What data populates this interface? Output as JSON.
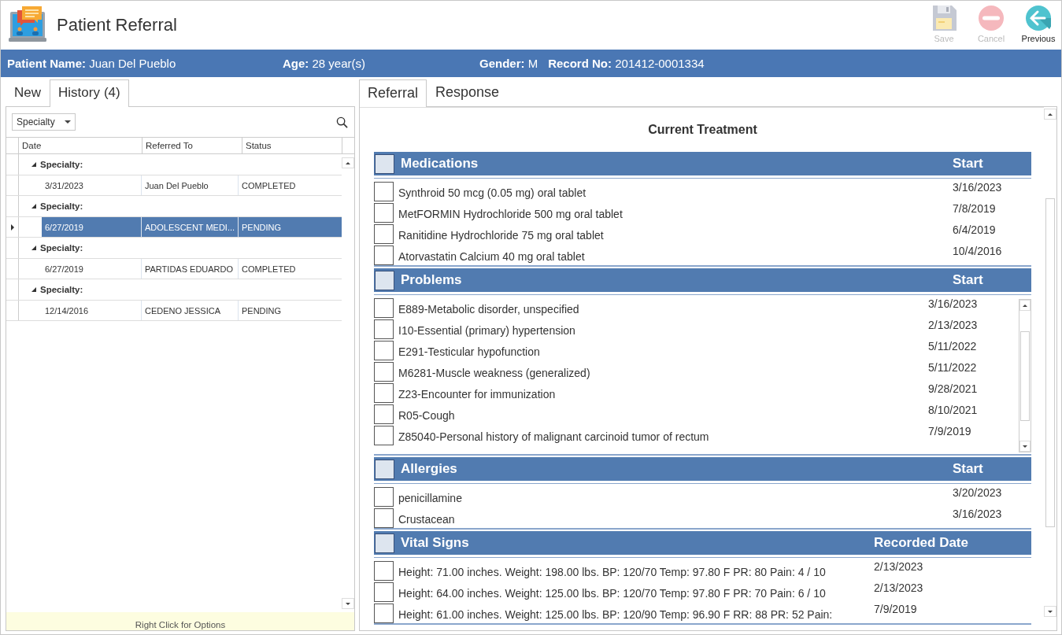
{
  "window": {
    "title": "Patient Referral"
  },
  "toolbar": [
    {
      "label": "Save",
      "kind": "save",
      "disabled": true
    },
    {
      "label": "Cancel",
      "kind": "cancel",
      "disabled": true
    },
    {
      "label": "Previous",
      "kind": "previous",
      "disabled": false
    }
  ],
  "patient_bar": [
    {
      "label": "Patient Name:",
      "value": "Juan Del Pueblo"
    },
    {
      "label": "Age:",
      "value": "28 year(s)"
    },
    {
      "label": "Gender:",
      "value": "M"
    },
    {
      "label": "Record No:",
      "value": "201412-0001334"
    }
  ],
  "left_tabs": [
    {
      "label": "New",
      "selected": false
    },
    {
      "label": "History",
      "count": "(4)",
      "selected": true
    }
  ],
  "filter": {
    "value": "Specialty"
  },
  "grid": {
    "columns": [
      "Date",
      "Referred To",
      "Status"
    ],
    "groups": [
      {
        "label": "Specialty:",
        "expanded": true,
        "rows": [
          {
            "date": "3/31/2023",
            "referred_to": "Juan  Del Pueblo",
            "status": "COMPLETED",
            "selected": false
          }
        ]
      },
      {
        "label": "Specialty:",
        "expanded": true,
        "rows": [
          {
            "date": "6/27/2019",
            "referred_to": "ADOLESCENT MEDI...",
            "status": "PENDING",
            "selected": true
          }
        ]
      },
      {
        "label": "Specialty:",
        "expanded": true,
        "rows": [
          {
            "date": "6/27/2019",
            "referred_to": "PARTIDAS EDUARDO",
            "status": "COMPLETED",
            "selected": false
          }
        ]
      },
      {
        "label": "Specialty:",
        "expanded": true,
        "rows": [
          {
            "date": "12/14/2016",
            "referred_to": "CEDENO JESSICA",
            "status": "PENDING",
            "selected": false
          }
        ]
      }
    ],
    "footer": "Right Click for Options"
  },
  "right_tabs": [
    {
      "label": "Referral",
      "selected": true
    },
    {
      "label": "Response",
      "selected": false
    }
  ],
  "current_treatment": {
    "title": "Current Treatment",
    "sections": [
      {
        "title": "Medications",
        "date_heading": "Start",
        "checked": false,
        "scrolling": false,
        "items": [
          {
            "text": "Synthroid 50 mcg (0.05 mg) oral tablet",
            "date": "3/16/2023",
            "checked": false
          },
          {
            "text": "MetFORMIN Hydrochloride 500 mg oral tablet",
            "date": "7/8/2019",
            "checked": false
          },
          {
            "text": "Ranitidine Hydrochloride 75 mg oral tablet",
            "date": "6/4/2019",
            "checked": false
          },
          {
            "text": "Atorvastatin Calcium 40 mg oral tablet",
            "date": "10/4/2016",
            "checked": false
          }
        ]
      },
      {
        "title": "Problems",
        "date_heading": "Start",
        "checked": false,
        "scrolling": true,
        "items": [
          {
            "text": "E889-Metabolic disorder, unspecified",
            "date": "3/16/2023",
            "checked": false
          },
          {
            "text": "I10-Essential (primary) hypertension",
            "date": "2/13/2023",
            "checked": false
          },
          {
            "text": "E291-Testicular hypofunction",
            "date": "5/11/2022",
            "checked": false
          },
          {
            "text": "M6281-Muscle weakness (generalized)",
            "date": "5/11/2022",
            "checked": false
          },
          {
            "text": "Z23-Encounter for immunization",
            "date": "9/28/2021",
            "checked": false
          },
          {
            "text": "R05-Cough",
            "date": "8/10/2021",
            "checked": false
          },
          {
            "text": "Z85040-Personal history of malignant carcinoid tumor of rectum",
            "date": "7/9/2019",
            "checked": false
          }
        ]
      },
      {
        "title": "Allergies",
        "date_heading": "Start",
        "checked": false,
        "scrolling": false,
        "items": [
          {
            "text": "penicillamine",
            "date": "3/20/2023",
            "checked": false
          },
          {
            "text": "Crustacean",
            "date": "3/16/2023",
            "checked": false
          }
        ]
      },
      {
        "title": "Vital Signs",
        "date_heading": "Recorded Date",
        "checked": false,
        "scrolling": false,
        "items": [
          {
            "text": "Height: 71.00 inches. Weight: 198.00 lbs. BP: 120/70 Temp: 97.80 F PR: 80 Pain: 4 / 10",
            "date": "2/13/2023",
            "checked": false
          },
          {
            "text": "Height: 64.00 inches. Weight: 125.00 lbs. BP: 120/70 Temp: 97.80 F PR: 70 Pain: 6 / 10",
            "date": "2/13/2023",
            "checked": false
          },
          {
            "text": "Height: 61.00 inches. Weight: 125.00 lbs. BP: 120/90 Temp: 96.90 F RR: 88 PR: 52 Pain:",
            "date": "7/9/2019",
            "checked": false
          }
        ]
      }
    ]
  }
}
